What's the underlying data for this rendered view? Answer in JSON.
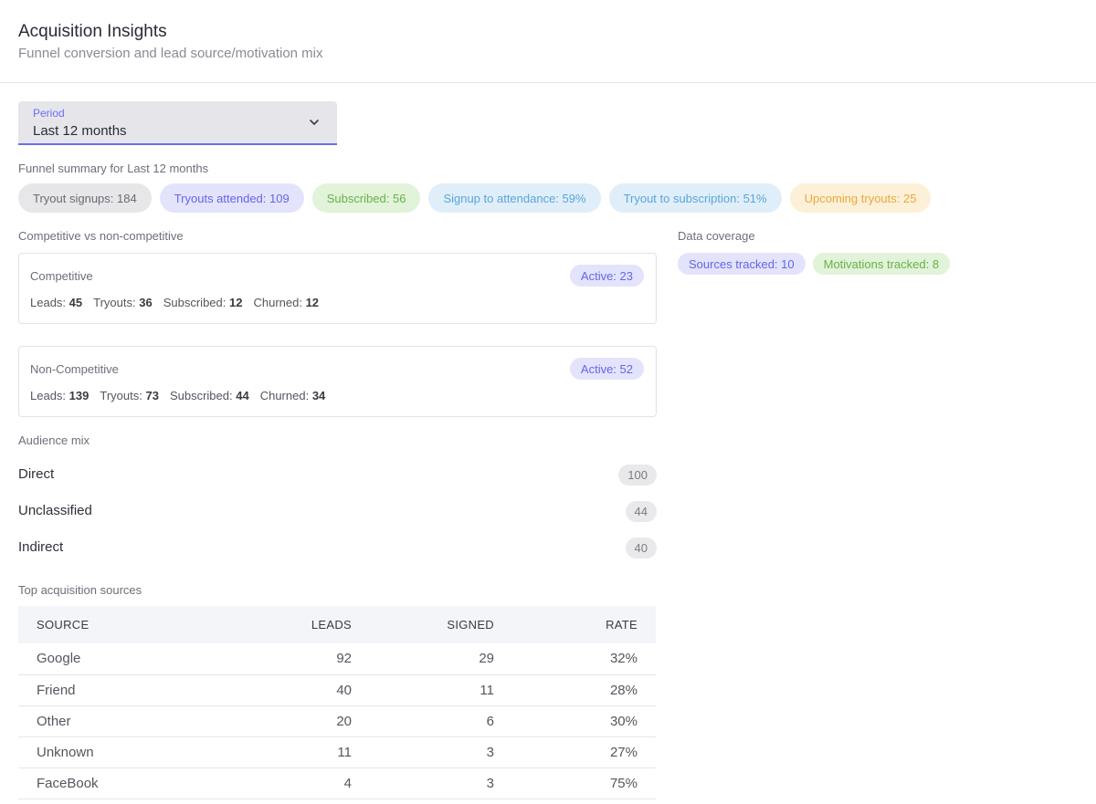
{
  "header": {
    "title": "Acquisition Insights",
    "subtitle": "Funnel conversion and lead source/motivation mix"
  },
  "period": {
    "label": "Period",
    "value": "Last 12 months",
    "icon": "chevron-down-icon"
  },
  "funnel": {
    "label": "Funnel summary for Last 12 months",
    "chips": [
      "Tryout signups: 184",
      "Tryouts attended: 109",
      "Subscribed: 56",
      "Signup to attendance: 59%",
      "Tryout to subscription: 51%",
      "Upcoming tryouts: 25"
    ]
  },
  "segments": {
    "label": "Competitive vs non-competitive",
    "competitive": {
      "name": "Competitive",
      "active": "Active: 23",
      "leads_label": "Leads:",
      "leads": "45",
      "tryouts_label": "Tryouts:",
      "tryouts": "36",
      "subscribed_label": "Subscribed:",
      "subscribed": "12",
      "churned_label": "Churned:",
      "churned": "12"
    },
    "non_competitive": {
      "name": "Non-Competitive",
      "active": "Active: 52",
      "leads_label": "Leads:",
      "leads": "139",
      "tryouts_label": "Tryouts:",
      "tryouts": "73",
      "subscribed_label": "Subscribed:",
      "subscribed": "44",
      "churned_label": "Churned:",
      "churned": "34"
    }
  },
  "coverage": {
    "label": "Data coverage",
    "sources": "Sources tracked: 10",
    "motivations": "Motivations tracked: 8"
  },
  "audience": {
    "label": "Audience mix",
    "items": [
      {
        "label": "Direct",
        "count": "100"
      },
      {
        "label": "Unclassified",
        "count": "44"
      },
      {
        "label": "Indirect",
        "count": "40"
      }
    ]
  },
  "sources": {
    "label": "Top acquisition sources",
    "columns": [
      "SOURCE",
      "LEADS",
      "SIGNED",
      "RATE"
    ],
    "rows": [
      {
        "source": "Google",
        "leads": "92",
        "signed": "29",
        "rate": "32%"
      },
      {
        "source": "Friend",
        "leads": "40",
        "signed": "11",
        "rate": "28%"
      },
      {
        "source": "Other",
        "leads": "20",
        "signed": "6",
        "rate": "30%"
      },
      {
        "source": "Unknown",
        "leads": "11",
        "signed": "3",
        "rate": "27%"
      },
      {
        "source": "FaceBook",
        "leads": "4",
        "signed": "3",
        "rate": "75%"
      }
    ]
  }
}
